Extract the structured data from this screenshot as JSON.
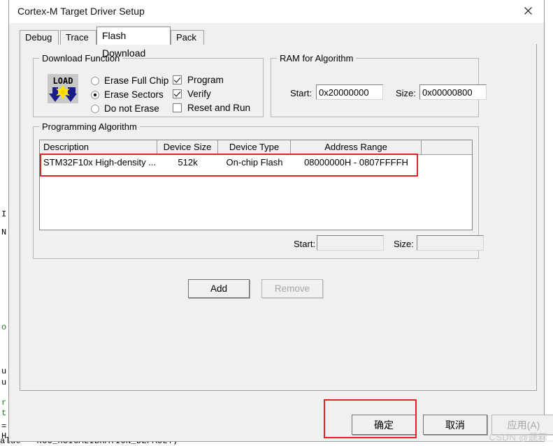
{
  "window": {
    "title": "Cortex-M Target Driver Setup",
    "close_icon": "close-icon"
  },
  "tabs": [
    {
      "label": "Debug",
      "active": false
    },
    {
      "label": "Trace",
      "active": false
    },
    {
      "label": "Flash Download",
      "active": true
    },
    {
      "label": "Pack",
      "active": false
    }
  ],
  "download_function": {
    "title": "Download Function",
    "icon": "load-icon",
    "icon_text": "LOAD",
    "radios": [
      {
        "label": "Erase Full Chip",
        "checked": false
      },
      {
        "label": "Erase Sectors",
        "checked": true
      },
      {
        "label": "Do not Erase",
        "checked": false
      }
    ],
    "checkboxes": [
      {
        "label": "Program",
        "checked": true
      },
      {
        "label": "Verify",
        "checked": true
      },
      {
        "label": "Reset and Run",
        "checked": false
      }
    ]
  },
  "ram_for_algorithm": {
    "title": "RAM for Algorithm",
    "start_label": "Start:",
    "start_value": "0x20000000",
    "size_label": "Size:",
    "size_value": "0x00000800"
  },
  "programming_algorithm": {
    "title": "Programming Algorithm",
    "columns": [
      "Description",
      "Device Size",
      "Device Type",
      "Address Range",
      ""
    ],
    "rows": [
      {
        "description": "STM32F10x High-density ...",
        "device_size": "512k",
        "device_type": "On-chip Flash",
        "address_range": "08000000H - 0807FFFFH",
        "extra": ""
      }
    ],
    "start_label": "Start:",
    "start_value": "",
    "size_label": "Size:",
    "size_value": "",
    "add_label": "Add",
    "remove_label": "Remove",
    "remove_enabled": false
  },
  "footer": {
    "ok_label": "确定",
    "cancel_label": "取消",
    "apply_label": "应用(A)",
    "apply_enabled": false
  },
  "annotations": {
    "accent_color": "#e02323"
  },
  "watermark": "CSDN @蔬菻",
  "background_editor": {
    "gutter_lines": [
      "I",
      "N",
      "o",
      "u",
      "u",
      "r",
      "t",
      "=",
      "H"
    ],
    "bottom_code": "alue = RCC_HSICALIBRATION_DEFAULT;"
  }
}
